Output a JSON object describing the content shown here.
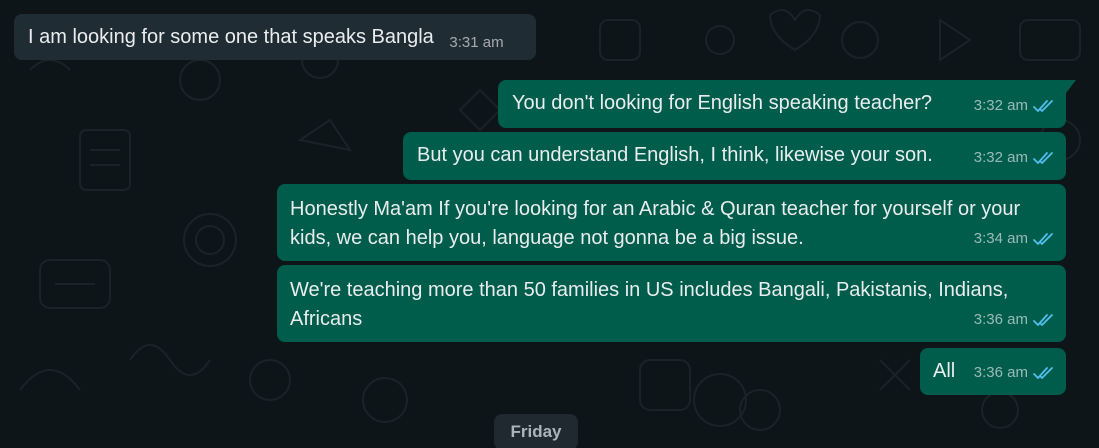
{
  "messages": [
    {
      "direction": "incoming",
      "text": "I am looking for some one that speaks Bangla",
      "time": "3:31 am"
    },
    {
      "direction": "outgoing",
      "text": "You don't looking for English speaking teacher?",
      "time": "3:32 am",
      "status": "read"
    },
    {
      "direction": "outgoing",
      "text": "But you can understand English, I think, likewise your son.",
      "time": "3:32 am",
      "status": "read"
    },
    {
      "direction": "outgoing",
      "text": "Honestly Ma'am If you're looking for an Arabic & Quran teacher for yourself or your kids, we can help you, language not gonna be a big issue.",
      "time": "3:34 am",
      "status": "read"
    },
    {
      "direction": "outgoing",
      "text": "We're teaching more than 50 families in US includes Bangali, Pakistanis, Indians, Africans",
      "time": "3:36 am",
      "status": "read"
    },
    {
      "direction": "outgoing",
      "text": "All",
      "time": "3:36 am",
      "status": "read"
    }
  ],
  "date_separator": "Friday",
  "colors": {
    "background": "#0e1519",
    "incoming_bubble": "#202c33",
    "outgoing_bubble": "#005c4b",
    "read_tick": "#53bdeb",
    "text": "#e9edef"
  },
  "icons": {
    "read_receipt": "double-check-icon"
  }
}
